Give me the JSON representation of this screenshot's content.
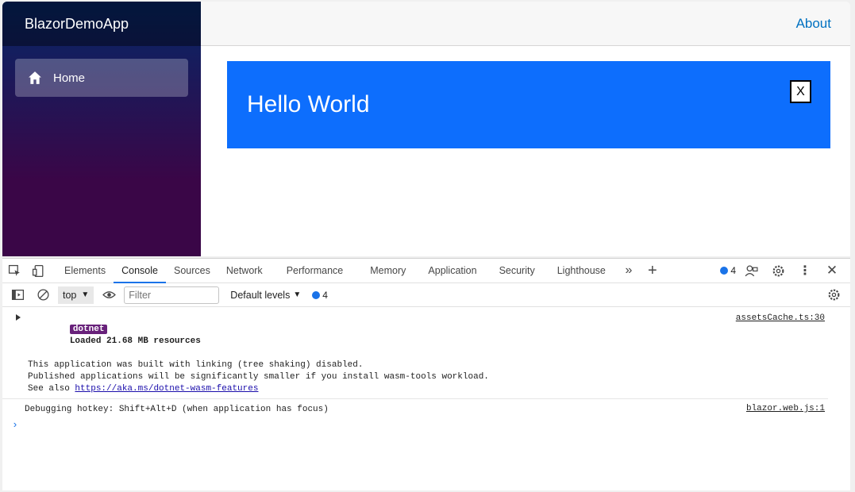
{
  "app": {
    "brand": "BlazorDemoApp",
    "nav": {
      "home_label": "Home"
    },
    "topbar": {
      "about_label": "About"
    },
    "content": {
      "heading": "Hello World",
      "close_label": "X"
    },
    "colors": {
      "accent": "#0d6efd",
      "sidebar_top": "#052767",
      "sidebar_bottom": "#3a0647",
      "link": "#0071c1"
    }
  },
  "devtools": {
    "tabs": [
      "Elements",
      "Console",
      "Sources",
      "Network",
      "Performance",
      "Memory",
      "Application",
      "Security",
      "Lighthouse"
    ],
    "active_tab": "Console",
    "message_count": "4",
    "toolbar": {
      "context": "top",
      "filter_placeholder": "Filter",
      "levels_label": "Default levels",
      "message_count": "4"
    },
    "messages": [
      {
        "tag": "dotnet",
        "title": "Loaded 21.68 MB resources",
        "lines": [
          "This application was built with linking (tree shaking) disabled.",
          "Published applications will be significantly smaller if you install wasm-tools workload.",
          "See also "
        ],
        "link": "https://aka.ms/dotnet-wasm-features",
        "source": "assetsCache.ts:30"
      },
      {
        "text": "Debugging hotkey: Shift+Alt+D (when application has focus)",
        "source": "blazor.web.js:1"
      }
    ],
    "prompt_symbol": "›"
  }
}
